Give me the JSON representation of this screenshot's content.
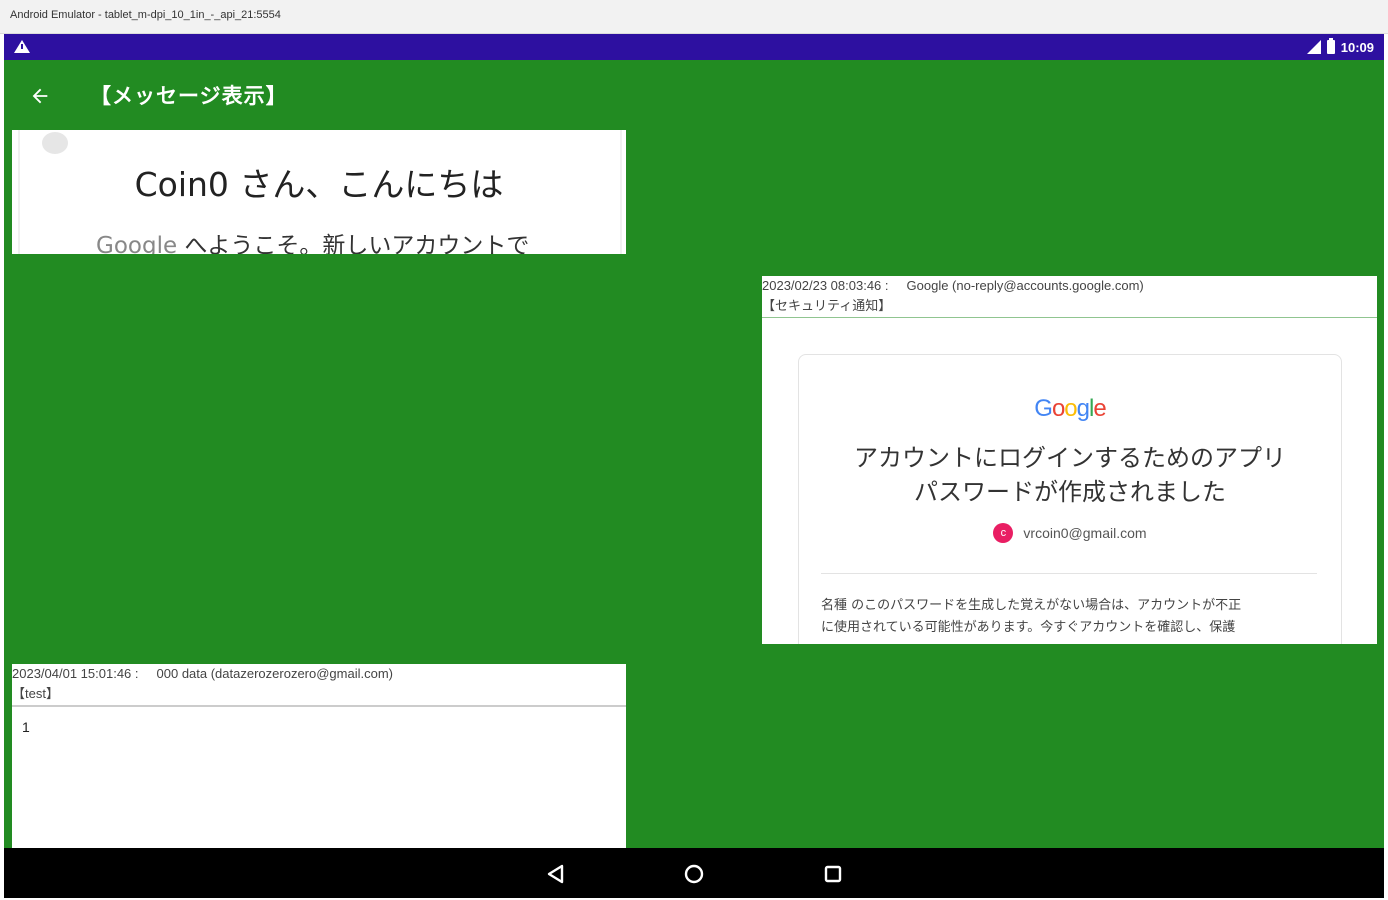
{
  "window": {
    "title": "Android Emulator - tablet_m-dpi_10_1in_-_api_21:5554"
  },
  "statusbar": {
    "time": "10:09",
    "warning_icon": "warning-icon",
    "signal_icon": "signal-icon",
    "battery_icon": "battery-icon"
  },
  "appbar": {
    "back_icon": "arrow-back-icon",
    "title": "【メッセージ表示】",
    "background": "#228b22"
  },
  "cards": {
    "welcome": {
      "heading": "Coin0 さん、こんにちは",
      "sub_google": "Google",
      "sub_rest": " へようこそ。新しいアカウントで"
    },
    "security": {
      "date": "2023/02/23 08:03:46 :",
      "sender": "Google (no-reply@accounts.google.com)",
      "subject": "【セキュリティ通知】",
      "logo_text": "Google",
      "title_line1": "アカウントにログインするためのアプリ",
      "title_line2": "パスワードが作成されました",
      "avatar_letter": "c",
      "email": "vrcoin0@gmail.com",
      "body_line1": "名種 のこのパスワードを生成した覚えがない場合は、アカウントが不正",
      "body_line2": "に使用されている可能性があります。今すぐアカウントを確認し、保護"
    },
    "test": {
      "date": "2023/04/01 15:01:46 :",
      "sender": "000 data (datazerozerozero@gmail.com)",
      "subject": "【test】",
      "body": "1"
    }
  },
  "navbar": {
    "back_icon": "nav-back-icon",
    "home_icon": "nav-home-icon",
    "recent_icon": "nav-recent-icon"
  },
  "colors": {
    "status_bar": "#2d10a0",
    "background": "#228b22",
    "accent": "#e91e63"
  }
}
